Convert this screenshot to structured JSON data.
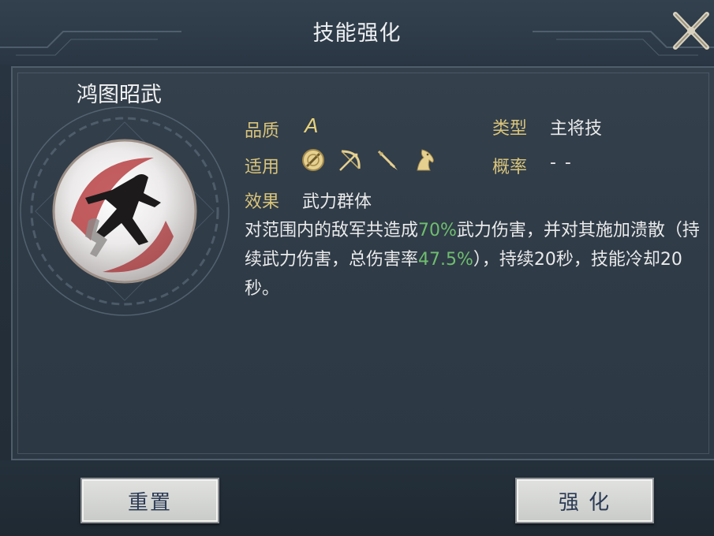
{
  "dialog": {
    "title": "技能强化"
  },
  "skill": {
    "name": "鸿图昭武",
    "quality_label": "品质",
    "quality_value": "A",
    "type_label": "类型",
    "type_value": "主将技",
    "apply_label": "适用",
    "apply_icons": [
      "shield-icon",
      "bow-icon",
      "spear-icon",
      "horse-icon"
    ],
    "chance_label": "概率",
    "chance_value": "- -",
    "effect_label": "效果",
    "effect_value": "武力群体",
    "description": {
      "part1": "对范围内的敌军共造成",
      "pct1": "70%",
      "part2": "武力伤害，并对其施加溃散（持续武力伤害，总伤害率",
      "pct2": "47.5%",
      "part3": "），持续20秒，技能冷却20秒。"
    }
  },
  "buttons": {
    "reset_label": "重置",
    "upgrade_label": "强 化"
  },
  "colors": {
    "label": "#d9c47a",
    "highlight": "#6fbe6e",
    "text": "#eaeaea"
  }
}
